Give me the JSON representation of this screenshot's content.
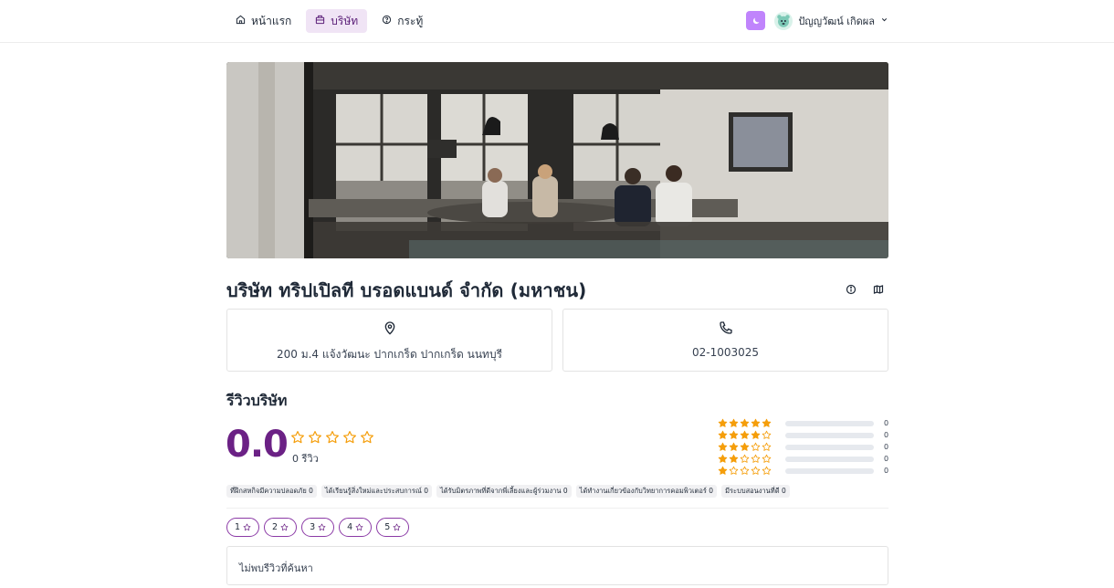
{
  "nav": {
    "items": [
      {
        "label": "หน้าแรก",
        "icon": "home-icon",
        "active": false
      },
      {
        "label": "บริษัท",
        "icon": "building-icon",
        "active": true
      },
      {
        "label": "กระทู้",
        "icon": "question-icon",
        "active": false
      }
    ]
  },
  "user": {
    "name": "ปัญญวัฒน์ เกิดผล",
    "icon": "avatar-icon"
  },
  "company": {
    "name": "บริษัท ทริปเปิลที บรอดแบนด์ จำกัด (มหาชน)",
    "address": "200 ม.4 แจ้งวัฒนะ ปากเกร็ด ปากเกร็ด นนทบุรี",
    "phone": "02-1003025"
  },
  "reviews": {
    "section_title": "รีวิวบริษัท",
    "score": "0.0",
    "rating_stars": 0,
    "count_text": "0 รีวิว",
    "distribution": [
      {
        "stars": 5,
        "count": "0",
        "fraction": 0
      },
      {
        "stars": 4,
        "count": "0",
        "fraction": 0
      },
      {
        "stars": 3,
        "count": "0",
        "fraction": 0
      },
      {
        "stars": 2,
        "count": "0",
        "fraction": 0
      },
      {
        "stars": 1,
        "count": "0",
        "fraction": 0
      }
    ],
    "tags": [
      "ที่ฝึกสหกิจมีความปลอดภัย 0",
      "ได้เรียนรู้สิ่งใหม่และประสบการณ์ 0",
      "ได้รับมิตรภาพที่ดีจากพี่เลี้ยงและผู้ร่วมงาน 0",
      "ได้ทำงานเกี่ยวข้องกับวิทยาการคอมพิวเตอร์ 0",
      "มีระบบสอนงานที่ดี 0"
    ],
    "filters": [
      "1",
      "2",
      "3",
      "4",
      "5"
    ],
    "empty_text": "ไม่พบรีวิวที่ค้นหา"
  },
  "colors": {
    "accent": "#6b2185",
    "star": "#f59e0b",
    "nav_active_bg": "#f0e4f5",
    "theme_button": "#c084fc"
  }
}
